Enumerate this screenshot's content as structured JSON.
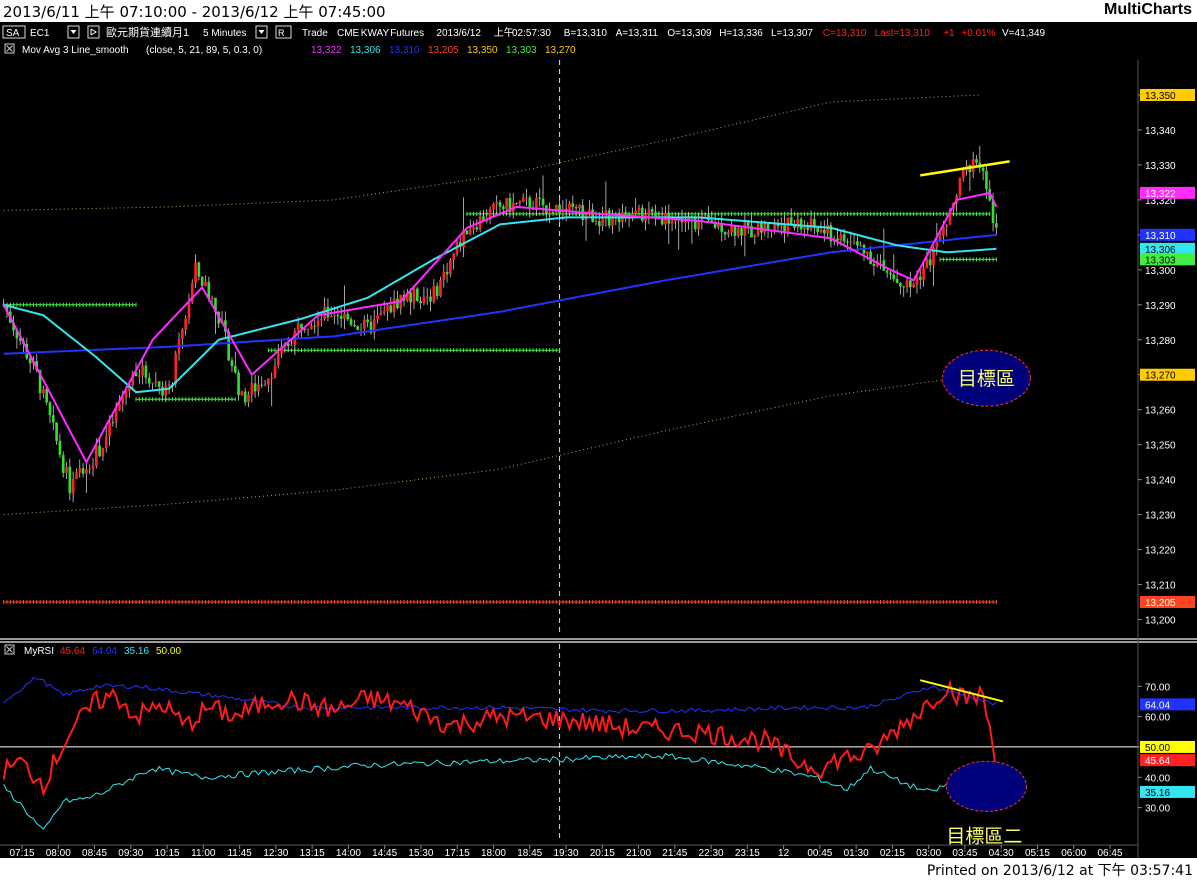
{
  "header": {
    "title": "2013/6/11 上午 07:10:00 - 2013/6/12 上午 07:45:00",
    "brand": "MultiCharts"
  },
  "footer": {
    "printed": "Printed on 2013/6/12 at 下午 03:57:41"
  },
  "toolbar": {
    "symbol_box": "SA",
    "symbol": "EC1",
    "name": "歐元期貨連續月1",
    "interval": "5 Minutes",
    "r_box": "R",
    "info": [
      "Trade",
      "CME",
      "KWAY",
      "Futures",
      "2013/6/12",
      "上午",
      "02:57:30",
      "B=13,310",
      "A=13,311",
      "O=13,309",
      "H=13,336",
      "L=13,307"
    ],
    "close_val": "C=13,310",
    "last_val": "Last=13,310",
    "change": "+1",
    "pct": "+0.01%",
    "volume": "V=41,349"
  },
  "indicators": {
    "ma_label": "Mov Avg 3 Line_smooth",
    "ma_params": "(close,  5,  21,  89,  5,  0.3,  0)",
    "ma_values": [
      {
        "text": "13,322",
        "color": "#ff2bff"
      },
      {
        "text": "13,306",
        "color": "#33e6f0"
      },
      {
        "text": "13,310",
        "color": "#2233ff"
      },
      {
        "text": "13,205",
        "color": "#ff4422"
      },
      {
        "text": "13,350",
        "color": "#ffcc00"
      },
      {
        "text": "13,303",
        "color": "#44ee44"
      },
      {
        "text": "13,270",
        "color": "#ffcc00"
      }
    ],
    "rsi_label": "MyRSI",
    "rsi_values": [
      {
        "text": "45.64",
        "color": "#ff2222"
      },
      {
        "text": "64.04",
        "color": "#2233ff"
      },
      {
        "text": "35.16",
        "color": "#33e6f0"
      },
      {
        "text": "50.00",
        "color": "#ffff00"
      }
    ]
  },
  "annotations": {
    "target1": "目標區",
    "target2": "目標區二"
  },
  "colors": {
    "background": "#000000",
    "up_candle": "#ff2222",
    "down_candle": "#33dd33",
    "ma_fast": "#ff2bff",
    "ma_mid": "#33e6f0",
    "ma_slow": "#2233ff",
    "rsi": "#ff1a1a",
    "rsi_upper": "#2233ff",
    "rsi_lower": "#33e6f0",
    "trendline": "#ffff00",
    "target_fill": "#00007a",
    "target_border": "#ff3333"
  },
  "chart_data": [
    {
      "type": "candlestick",
      "series_name": "EC1 5 Minutes",
      "ylim": [
        13195,
        13360
      ],
      "y_ticks": [
        13200,
        13210,
        13220,
        13230,
        13240,
        13250,
        13260,
        13270,
        13280,
        13290,
        13300,
        13310,
        13320,
        13330,
        13340,
        13350
      ],
      "x_ticks": [
        "07:15",
        "08:00",
        "08:45",
        "09:30",
        "10:15",
        "11:00",
        "11:45",
        "12:30",
        "13:15",
        "14:00",
        "14:45",
        "15:30",
        "17:15",
        "18:00",
        "18:45",
        "19:30",
        "20:15",
        "21:00",
        "21:45",
        "22:30",
        "23:15",
        "12",
        "00:45",
        "01:30",
        "02:15",
        "03:00",
        "03:45",
        "04:30",
        "05:15",
        "06:00",
        "06:45"
      ],
      "price_markers": [
        {
          "value": 13350,
          "text": "13,350",
          "bg": "#ffcc00",
          "fg": "#000000"
        },
        {
          "value": 13322,
          "text": "13,322",
          "bg": "#ff2bff",
          "fg": "#ffffff"
        },
        {
          "value": 13310,
          "text": "13,310",
          "bg": "#2233ff",
          "fg": "#ffffff"
        },
        {
          "value": 13306,
          "text": "13,306",
          "bg": "#33e6f0",
          "fg": "#000000"
        },
        {
          "value": 13303,
          "text": "13,303",
          "bg": "#44ee44",
          "fg": "#000000"
        },
        {
          "value": 13270,
          "text": "13,270",
          "bg": "#ffcc00",
          "fg": "#000000"
        },
        {
          "value": 13205,
          "text": "13,205",
          "bg": "#ff4422",
          "fg": "#ffffff"
        }
      ],
      "key_points": [
        [
          0,
          13290
        ],
        [
          10,
          13270
        ],
        [
          20,
          13238
        ],
        [
          30,
          13250
        ],
        [
          40,
          13272
        ],
        [
          50,
          13265
        ],
        [
          58,
          13300
        ],
        [
          64,
          13290
        ],
        [
          72,
          13263
        ],
        [
          80,
          13270
        ],
        [
          90,
          13285
        ],
        [
          100,
          13288
        ],
        [
          110,
          13283
        ],
        [
          120,
          13292
        ],
        [
          130,
          13293
        ],
        [
          140,
          13312
        ],
        [
          150,
          13318
        ],
        [
          160,
          13319
        ],
        [
          170,
          13317
        ],
        [
          175,
          13316
        ],
        [
          185,
          13314
        ],
        [
          195,
          13316
        ],
        [
          205,
          13314
        ],
        [
          215,
          13313
        ],
        [
          225,
          13311
        ],
        [
          235,
          13313
        ],
        [
          245,
          13312
        ],
        [
          250,
          13310
        ],
        [
          260,
          13306
        ],
        [
          268,
          13298
        ],
        [
          274,
          13295
        ],
        [
          280,
          13303
        ],
        [
          285,
          13313
        ],
        [
          290,
          13327
        ],
        [
          294,
          13333
        ],
        [
          296,
          13326
        ],
        [
          298,
          13318
        ],
        [
          300,
          13310
        ]
      ],
      "ma_fast_points": [
        [
          0,
          13290
        ],
        [
          25,
          13245
        ],
        [
          45,
          13280
        ],
        [
          60,
          13295
        ],
        [
          75,
          13270
        ],
        [
          95,
          13287
        ],
        [
          120,
          13291
        ],
        [
          140,
          13312
        ],
        [
          155,
          13318
        ],
        [
          180,
          13316
        ],
        [
          210,
          13314
        ],
        [
          250,
          13309
        ],
        [
          268,
          13300
        ],
        [
          275,
          13297
        ],
        [
          288,
          13320
        ],
        [
          298,
          13322
        ],
        [
          300,
          13318
        ]
      ],
      "ma_mid_points": [
        [
          0,
          13290
        ],
        [
          12,
          13287
        ],
        [
          28,
          13275
        ],
        [
          40,
          13265
        ],
        [
          50,
          13266
        ],
        [
          65,
          13280
        ],
        [
          90,
          13286
        ],
        [
          110,
          13292
        ],
        [
          130,
          13303
        ],
        [
          150,
          13313
        ],
        [
          170,
          13315
        ],
        [
          210,
          13315
        ],
        [
          250,
          13312
        ],
        [
          270,
          13307
        ],
        [
          285,
          13305
        ],
        [
          300,
          13306
        ]
      ],
      "ma_slow_points": [
        [
          0,
          13276
        ],
        [
          50,
          13278
        ],
        [
          100,
          13281
        ],
        [
          150,
          13288
        ],
        [
          200,
          13297
        ],
        [
          250,
          13305
        ],
        [
          300,
          13310
        ]
      ],
      "band_upper_points": [
        [
          0,
          13317
        ],
        [
          50,
          13318
        ],
        [
          100,
          13320
        ],
        [
          150,
          13327
        ],
        [
          200,
          13337
        ],
        [
          250,
          13348
        ],
        [
          295,
          13350
        ]
      ],
      "band_lower_points": [
        [
          0,
          13230
        ],
        [
          50,
          13233
        ],
        [
          100,
          13237
        ],
        [
          150,
          13243
        ],
        [
          200,
          13254
        ],
        [
          250,
          13264
        ],
        [
          295,
          13270
        ]
      ],
      "level_lines": [
        {
          "value": 13290,
          "from": 0,
          "to": 40,
          "color": "#44ee44"
        },
        {
          "value": 13263,
          "from": 40,
          "to": 70,
          "color": "#44ee44"
        },
        {
          "value": 13277,
          "from": 80,
          "to": 168,
          "color": "#44ee44"
        },
        {
          "value": 13316,
          "from": 140,
          "to": 298,
          "color": "#44ee44"
        },
        {
          "value": 13303,
          "from": 283,
          "to": 300,
          "color": "#44ee44"
        },
        {
          "value": 13205,
          "from": 0,
          "to": 300,
          "color": "#ff4422"
        }
      ],
      "trendline": [
        [
          277,
          13327
        ],
        [
          304,
          13331
        ]
      ],
      "target_zone": {
        "x": 297,
        "value": 13269
      }
    },
    {
      "type": "line",
      "series_name": "MyRSI",
      "ylim": [
        18,
        78
      ],
      "y_ticks": [
        30,
        40,
        50,
        60,
        70
      ],
      "y_tick_labels": [
        "30.00",
        "40.00",
        "50.00",
        "60.00",
        "70.00"
      ],
      "reference_line": 50,
      "price_markers": [
        {
          "value": 64.04,
          "text": "64.04",
          "bg": "#2233ff",
          "fg": "#ffffff"
        },
        {
          "value": 50.0,
          "text": "50.00",
          "bg": "#ffff00",
          "fg": "#000000"
        },
        {
          "value": 45.64,
          "text": "45.64",
          "bg": "#ff2222",
          "fg": "#ffffff"
        },
        {
          "value": 35.16,
          "text": "35.16",
          "bg": "#33e6f0",
          "fg": "#000000"
        }
      ],
      "rsi_points": [
        [
          0,
          42
        ],
        [
          5,
          45
        ],
        [
          12,
          38
        ],
        [
          20,
          55
        ],
        [
          28,
          65
        ],
        [
          34,
          67
        ],
        [
          40,
          60
        ],
        [
          48,
          64
        ],
        [
          55,
          57
        ],
        [
          62,
          63
        ],
        [
          70,
          60
        ],
        [
          80,
          65
        ],
        [
          85,
          66
        ],
        [
          100,
          62
        ],
        [
          110,
          66
        ],
        [
          120,
          64
        ],
        [
          135,
          57
        ],
        [
          150,
          60
        ],
        [
          170,
          59
        ],
        [
          190,
          56
        ],
        [
          210,
          55
        ],
        [
          230,
          52
        ],
        [
          240,
          45
        ],
        [
          248,
          43
        ],
        [
          252,
          46
        ],
        [
          262,
          48
        ],
        [
          270,
          56
        ],
        [
          278,
          63
        ],
        [
          285,
          70
        ],
        [
          290,
          66
        ],
        [
          296,
          67
        ],
        [
          300,
          45
        ]
      ],
      "upper_points": [
        [
          0,
          65
        ],
        [
          10,
          73
        ],
        [
          18,
          67
        ],
        [
          28,
          70
        ],
        [
          40,
          70
        ],
        [
          55,
          68
        ],
        [
          70,
          66
        ],
        [
          90,
          63
        ],
        [
          120,
          63
        ],
        [
          150,
          63
        ],
        [
          180,
          62
        ],
        [
          210,
          62
        ],
        [
          240,
          63
        ],
        [
          260,
          63
        ],
        [
          270,
          66
        ],
        [
          280,
          70
        ],
        [
          290,
          67
        ],
        [
          300,
          64
        ]
      ],
      "lower_points": [
        [
          0,
          37
        ],
        [
          6,
          30
        ],
        [
          12,
          22
        ],
        [
          18,
          32
        ],
        [
          25,
          33
        ],
        [
          30,
          35
        ],
        [
          45,
          43
        ],
        [
          60,
          40
        ],
        [
          85,
          42
        ],
        [
          110,
          44
        ],
        [
          140,
          45
        ],
        [
          170,
          46
        ],
        [
          200,
          47
        ],
        [
          230,
          43
        ],
        [
          245,
          40
        ],
        [
          255,
          36
        ],
        [
          262,
          43
        ],
        [
          272,
          38
        ],
        [
          280,
          35
        ],
        [
          290,
          40
        ],
        [
          296,
          36
        ],
        [
          300,
          35
        ]
      ],
      "trendline": [
        [
          277,
          72
        ],
        [
          302,
          65
        ]
      ],
      "target_zone": {
        "x": 297,
        "value": 37
      }
    }
  ]
}
